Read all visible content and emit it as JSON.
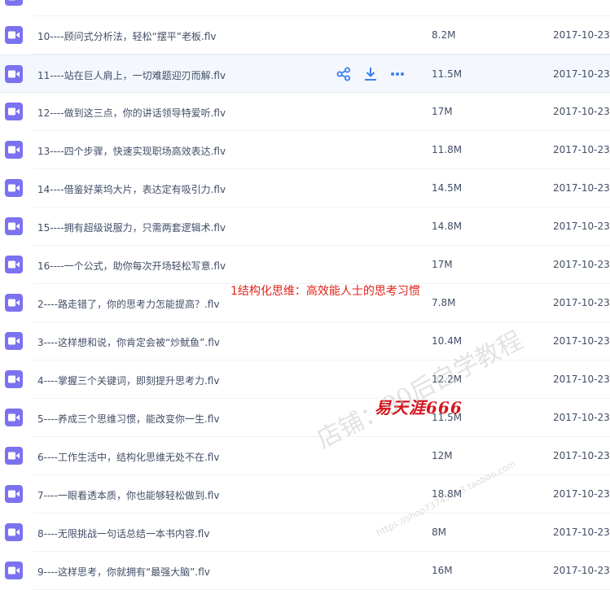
{
  "files": [
    {
      "name": "",
      "size": "",
      "date": "",
      "partial": true
    },
    {
      "name": "10----顾问式分析法，轻松“摆平”老板.flv",
      "size": "8.2M",
      "date": "2017-10-23"
    },
    {
      "name": "11----站在巨人肩上，一切难题迎刃而解.flv",
      "size": "11.5M",
      "date": "2017-10-23",
      "hover": true
    },
    {
      "name": "12----做到这三点，你的讲话领导特爱听.flv",
      "size": "17M",
      "date": "2017-10-23"
    },
    {
      "name": "13----四个步骤，快速实现职场高效表达.flv",
      "size": "11.8M",
      "date": "2017-10-23"
    },
    {
      "name": "14----借鉴好莱坞大片，表达定有吸引力.flv",
      "size": "14.5M",
      "date": "2017-10-23"
    },
    {
      "name": "15----拥有超级说服力，只需两套逻辑术.flv",
      "size": "14.8M",
      "date": "2017-10-23"
    },
    {
      "name": "16----一个公式，助你每次开场轻松写意.flv",
      "size": "17M",
      "date": "2017-10-23"
    },
    {
      "name": "2----路走错了，你的思考力怎能提高？.flv",
      "size": "7.8M",
      "date": "2017-10-23"
    },
    {
      "name": "3----这样想和说，你肯定会被“炒鱿鱼”.flv",
      "size": "10.4M",
      "date": "2017-10-23"
    },
    {
      "name": "4----掌握三个关键词，即刻提升思考力.flv",
      "size": "12.2M",
      "date": "2017-10-23"
    },
    {
      "name": "5----养成三个思维习惯，能改变你一生.flv",
      "size": "11.5M",
      "date": "2017-10-23"
    },
    {
      "name": "6----工作生活中，结构化思维无处不在.flv",
      "size": "12M",
      "date": "2017-10-23"
    },
    {
      "name": "7----一眼看透本质，你也能够轻松做到.flv",
      "size": "18.8M",
      "date": "2017-10-23"
    },
    {
      "name": "8----无限挑战一句话总结一本书内容.flv",
      "size": "8M",
      "date": "2017-10-23"
    },
    {
      "name": "9----这样思考，你就拥有“最强大脑”.flv",
      "size": "16M",
      "date": "2017-10-23"
    }
  ],
  "row_actions": [
    {
      "icon": "share-icon",
      "color": "#3d7df2"
    },
    {
      "icon": "download-icon",
      "color": "#3d7df2"
    },
    {
      "icon": "more-icon",
      "color": "#3d7df2"
    }
  ],
  "overlay": {
    "title": "1结构化思维：高效能人士的思考习惯",
    "brand": "易天涯666",
    "shop_watermark": "店铺：90后自学教程",
    "url_watermark": "https://shop73747113.taobao.com"
  },
  "colors": {
    "file_icon": "#7b72f0",
    "hover_row": "#f4f8fe",
    "text": "#424e67",
    "overlay_red": "#e2231a"
  }
}
